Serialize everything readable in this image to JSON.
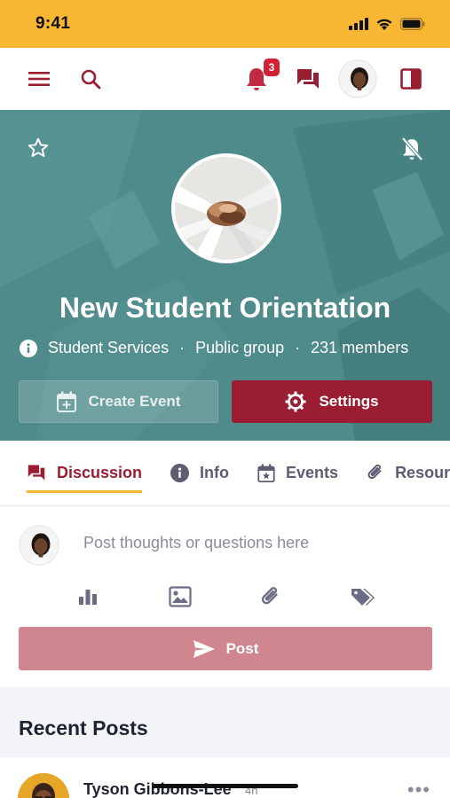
{
  "status_bar": {
    "time": "9:41"
  },
  "top_nav": {
    "notification_count": "3"
  },
  "group": {
    "title": "New Student Orientation",
    "category": "Student Services",
    "privacy": "Public group",
    "members": "231 members",
    "separator": "·"
  },
  "actions": {
    "create_event": "Create Event",
    "settings": "Settings"
  },
  "tabs": [
    {
      "label": "Discussion",
      "icon": "discussion-icon"
    },
    {
      "label": "Info",
      "icon": "info-icon"
    },
    {
      "label": "Events",
      "icon": "calendar-icon"
    },
    {
      "label": "Resources",
      "icon": "paperclip-icon"
    }
  ],
  "composer": {
    "placeholder": "Post thoughts or questions here",
    "post_label": "Post",
    "tools": [
      "poll-icon",
      "image-icon",
      "attachment-icon",
      "tag-icon"
    ]
  },
  "recent": {
    "title": "Recent Posts",
    "first_post": {
      "author": "Tyson Gibbons-Lee",
      "time": "4h",
      "more": "•••"
    }
  },
  "colors": {
    "accent": "#9b1d32",
    "status_bar": "#f7b733",
    "hero": "#4e8a8a",
    "post_button": "#d0868e"
  }
}
